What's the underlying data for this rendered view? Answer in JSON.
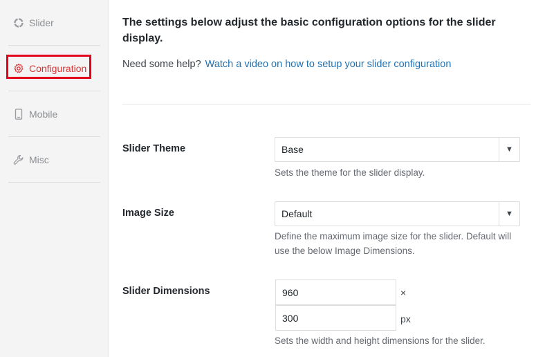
{
  "sidebar": {
    "items": [
      {
        "label": "Slider",
        "icon": "slider-icon"
      },
      {
        "label": "Configuration",
        "icon": "gear-icon"
      },
      {
        "label": "Mobile",
        "icon": "mobile-icon"
      },
      {
        "label": "Misc",
        "icon": "wrench-icon"
      }
    ],
    "active_color": "#d63638"
  },
  "main": {
    "heading": "The settings below adjust the basic configuration options for the slider display.",
    "help_text": "Need some help?",
    "help_link": "Watch a video on how to setup your slider configuration",
    "fields": {
      "theme": {
        "label": "Slider Theme",
        "value": "Base",
        "description": "Sets the theme for the slider display."
      },
      "image_size": {
        "label": "Image Size",
        "value": "Default",
        "description": "Define the maximum image size for the slider. Default will use the below Image Dimensions."
      },
      "dimensions": {
        "label": "Slider Dimensions",
        "width": "960",
        "height": "300",
        "times_symbol": "×",
        "unit": "px",
        "description": "Sets the width and height dimensions for the slider."
      }
    }
  }
}
